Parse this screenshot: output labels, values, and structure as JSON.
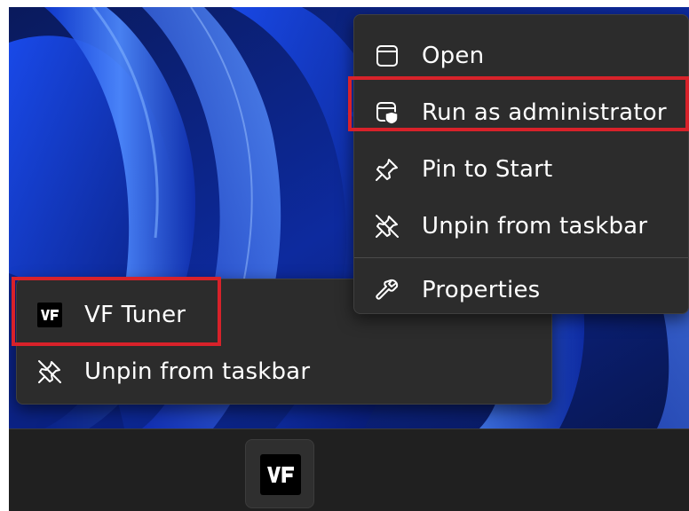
{
  "wallpaper": {
    "base_color": "#0b1d6b",
    "accent_color": "#1f5cff",
    "highlight_color": "#4f8bff"
  },
  "taskbar": {
    "pinned_app": {
      "icon": "vf-tuner-logo-icon",
      "logo_text": "VF"
    }
  },
  "context_menu": {
    "items": [
      {
        "label": "Open",
        "icon": "window-icon"
      },
      {
        "label": "Run as administrator",
        "icon": "shield-window-icon",
        "highlighted": true
      },
      {
        "label": "Pin to Start",
        "icon": "pin-icon"
      },
      {
        "label": "Unpin from taskbar",
        "icon": "unpin-icon"
      },
      {
        "label": "Properties",
        "icon": "wrench-icon"
      }
    ]
  },
  "jump_list": {
    "items": [
      {
        "label": "VF Tuner",
        "icon": "vf-tuner-logo-icon",
        "logo_text": "VF",
        "highlighted": true
      },
      {
        "label": "Unpin from taskbar",
        "icon": "unpin-icon"
      }
    ]
  },
  "highlight_color": "#d8222a"
}
